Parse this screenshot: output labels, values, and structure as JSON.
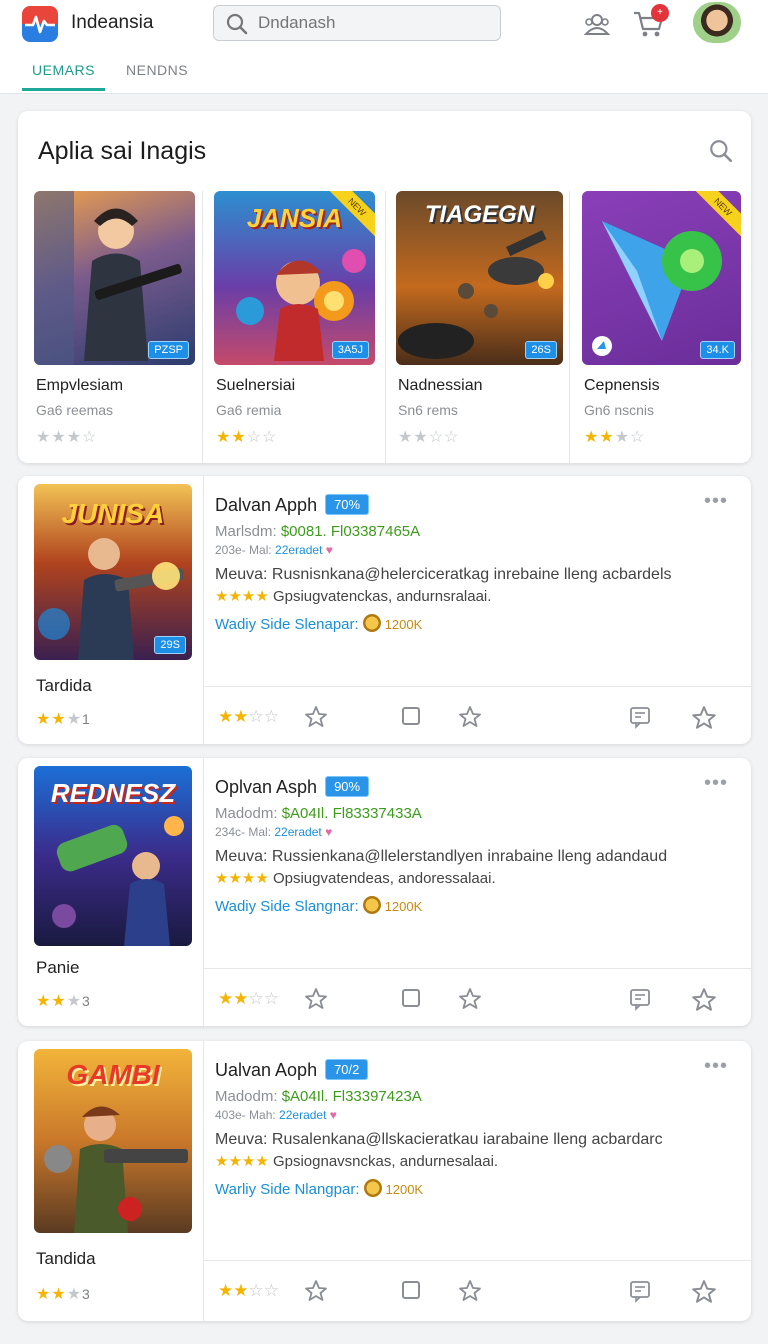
{
  "header": {
    "app_title": "Indeansia",
    "search_placeholder": "Dndanash",
    "cart_badge": "+",
    "tabs": [
      {
        "label": "UEMARS",
        "active": true
      },
      {
        "label": "NENDNS",
        "active": false
      }
    ]
  },
  "featured": {
    "title": "Aplia sai Inagis",
    "tiles": [
      {
        "name": "Empvlesiam",
        "sub": "Ga6 reemas",
        "badge": "PZSP",
        "art_text": "",
        "corner": "",
        "stars": 3
      },
      {
        "name": "Suelnersiai",
        "sub": "Ga6 remia",
        "badge": "3A5J",
        "art_text": "JANSIA",
        "corner": "NEW",
        "stars": 2
      },
      {
        "name": "Nadnessian",
        "sub": "Sn6 rems",
        "badge": "26S",
        "art_text": "TIAGEGN",
        "corner": "",
        "stars": 2
      },
      {
        "name": "Cepnensis",
        "sub": "Gn6 nscnis",
        "badge": "34.K",
        "art_text": "",
        "corner": "NEW",
        "stars": 3
      }
    ]
  },
  "cards": [
    {
      "art_text": "JUNISA",
      "badge": "29S",
      "left_name": "Tardida",
      "left_count": "1",
      "title": "Dalvan Apph",
      "pill": "70%",
      "r1_label": "Marlsdm: ",
      "r1_value": "$0081. Fl03387465A",
      "r2_prefix": "203e- Mal: ",
      "r2_link": "22eradet",
      "r2_heart": "♥",
      "r3": "Meuva: Rusnisnkana@helerciceratkag inrebaine lleng acbardels",
      "r4_stars": "★★★★",
      "r4_text": " Gpsiugvatenckas, andurnsralaai.",
      "r5_text": "Wadiy Side Slenapar:",
      "r5_amount": "1200K"
    },
    {
      "art_text": "REDNESZ",
      "badge": "",
      "left_name": "Panie",
      "left_count": "3",
      "title": "Oplvan Asph",
      "pill": "90%",
      "r1_label": "Madodm: ",
      "r1_value": "$A04Il. Fl83337433A",
      "r2_prefix": "234c- Mal: ",
      "r2_link": "22eradet",
      "r2_heart": "♥",
      "r3": "Meuva: Russienkana@llelerstandlyen inrabaine lleng adandaud",
      "r4_stars": "★★★★",
      "r4_text": " Opsiugvatendeas, andoressalaai.",
      "r5_text": "Wadiy Side Slangnar:",
      "r5_amount": "1200K"
    },
    {
      "art_text": "GAMBI",
      "badge": "",
      "left_name": "Tandida",
      "left_count": "3",
      "title": "Ualvan Aoph",
      "pill": "70/2",
      "r1_label": "Madodm: ",
      "r1_value": "$A04Il. Fl33397423A",
      "r2_prefix": "403e- Mah: ",
      "r2_link": "22eradet",
      "r2_heart": "♥",
      "r3": "Meuva: Rusalenkana@llskacieratkau iarabaine lleng acbardarc",
      "r4_stars": "★★★★",
      "r4_text": " Gpsiognavsnckas, andurnesalaai.",
      "r5_text": "Warliy Side Nlangpar:",
      "r5_amount": "1200K"
    }
  ],
  "colors": {
    "accent": "#1fa99a",
    "badge_blue": "#2a95e8",
    "star": "#f5b400",
    "price_green": "#3d9b1c"
  }
}
